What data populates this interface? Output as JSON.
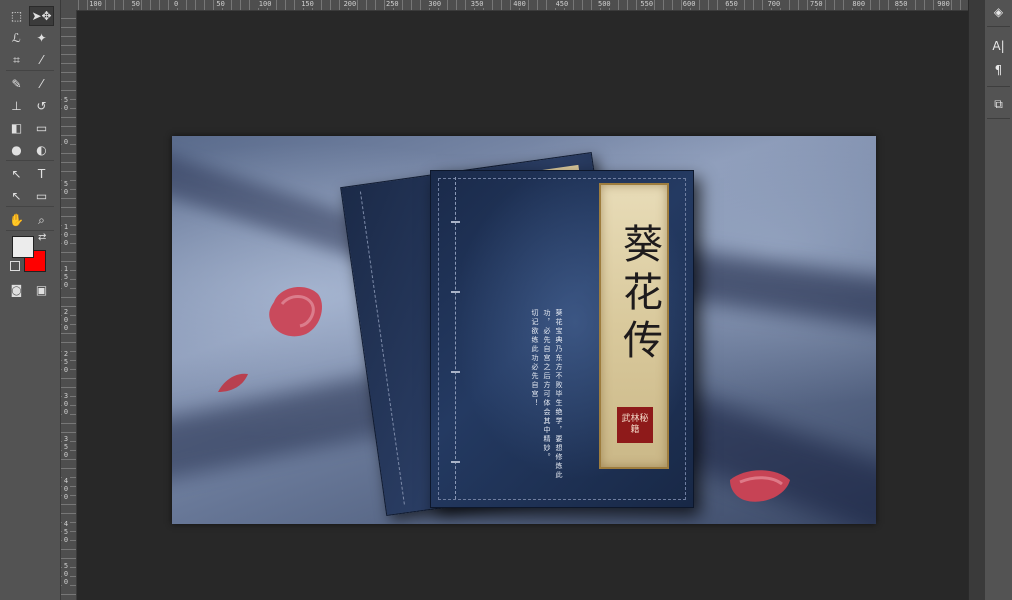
{
  "toolbar": {
    "tools": [
      {
        "name": "marquee-tool",
        "glyph": "⬚"
      },
      {
        "name": "move-tool",
        "glyph": "➤✥"
      },
      {
        "name": "lasso-tool",
        "glyph": "ℒ"
      },
      {
        "name": "magic-wand-tool",
        "glyph": "✦"
      },
      {
        "name": "crop-tool",
        "glyph": "⌗"
      },
      {
        "name": "eyedropper-tool",
        "glyph": "⁄"
      },
      {
        "name": "healing-brush-tool",
        "glyph": "✎"
      },
      {
        "name": "brush-tool",
        "glyph": "⁄"
      },
      {
        "name": "clone-stamp-tool",
        "glyph": "⊥"
      },
      {
        "name": "history-brush-tool",
        "glyph": "↺"
      },
      {
        "name": "eraser-tool",
        "glyph": "◧"
      },
      {
        "name": "gradient-tool",
        "glyph": "▭"
      },
      {
        "name": "blur-tool",
        "glyph": "●"
      },
      {
        "name": "dodge-tool",
        "glyph": "◐"
      },
      {
        "name": "path-selection-tool",
        "glyph": "↖"
      },
      {
        "name": "type-tool",
        "glyph": "T"
      },
      {
        "name": "direct-selection-tool",
        "glyph": "↖"
      },
      {
        "name": "rectangle-tool",
        "glyph": "▭"
      },
      {
        "name": "hand-tool",
        "glyph": "✋"
      },
      {
        "name": "zoom-tool",
        "glyph": "⌕"
      },
      {
        "name": "quick-mask-button",
        "glyph": "◙"
      },
      {
        "name": "screen-mode-button",
        "glyph": "▣"
      }
    ],
    "foreground_color": "#ececec",
    "background_color": "#ff0000"
  },
  "rulers": {
    "horizontal": [
      "100",
      "50",
      "0",
      "50",
      "100",
      "150",
      "200",
      "250",
      "300",
      "350",
      "400",
      "450",
      "500",
      "550",
      "600",
      "650",
      "700",
      "750",
      "800",
      "850",
      "900"
    ],
    "vertical": [
      "50",
      "0",
      "50",
      "100",
      "150",
      "200",
      "250",
      "300",
      "350",
      "400",
      "450",
      "500",
      "550"
    ]
  },
  "right_panel": {
    "buttons": [
      {
        "name": "3d-panel-button",
        "glyph": "◈"
      },
      {
        "name": "character-panel-button",
        "glyph": "A|"
      },
      {
        "name": "paragraph-panel-button",
        "glyph": "¶"
      },
      {
        "name": "paths-panel-button",
        "glyph": "⧉"
      }
    ]
  },
  "artwork": {
    "title": "葵花传",
    "seal": "武林秘籍",
    "poem": "葵花宝典乃东方不败毕生绝学，要想修炼此功，必先自宫之后方可体会其中精妙。\n切记欲练此功必先自宫！"
  }
}
